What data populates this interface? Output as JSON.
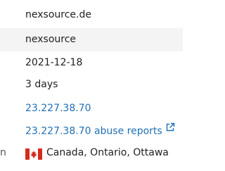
{
  "details": {
    "domain": "nexsource.de",
    "registrant": "nexsource",
    "date": "2021-12-18",
    "age": "3 days",
    "ip": "23.227.38.70",
    "abuse_link": "23.227.38.70 abuse reports",
    "location_label_stub": "n",
    "location": "Canada, Ontario, Ottawa"
  },
  "icons": {
    "external": "external-link-icon",
    "flag": "canada-flag-icon"
  },
  "colors": {
    "link": "#1f6fb5",
    "shaded_row": "#f4f4f4",
    "flag_red": "#d52b1e"
  }
}
